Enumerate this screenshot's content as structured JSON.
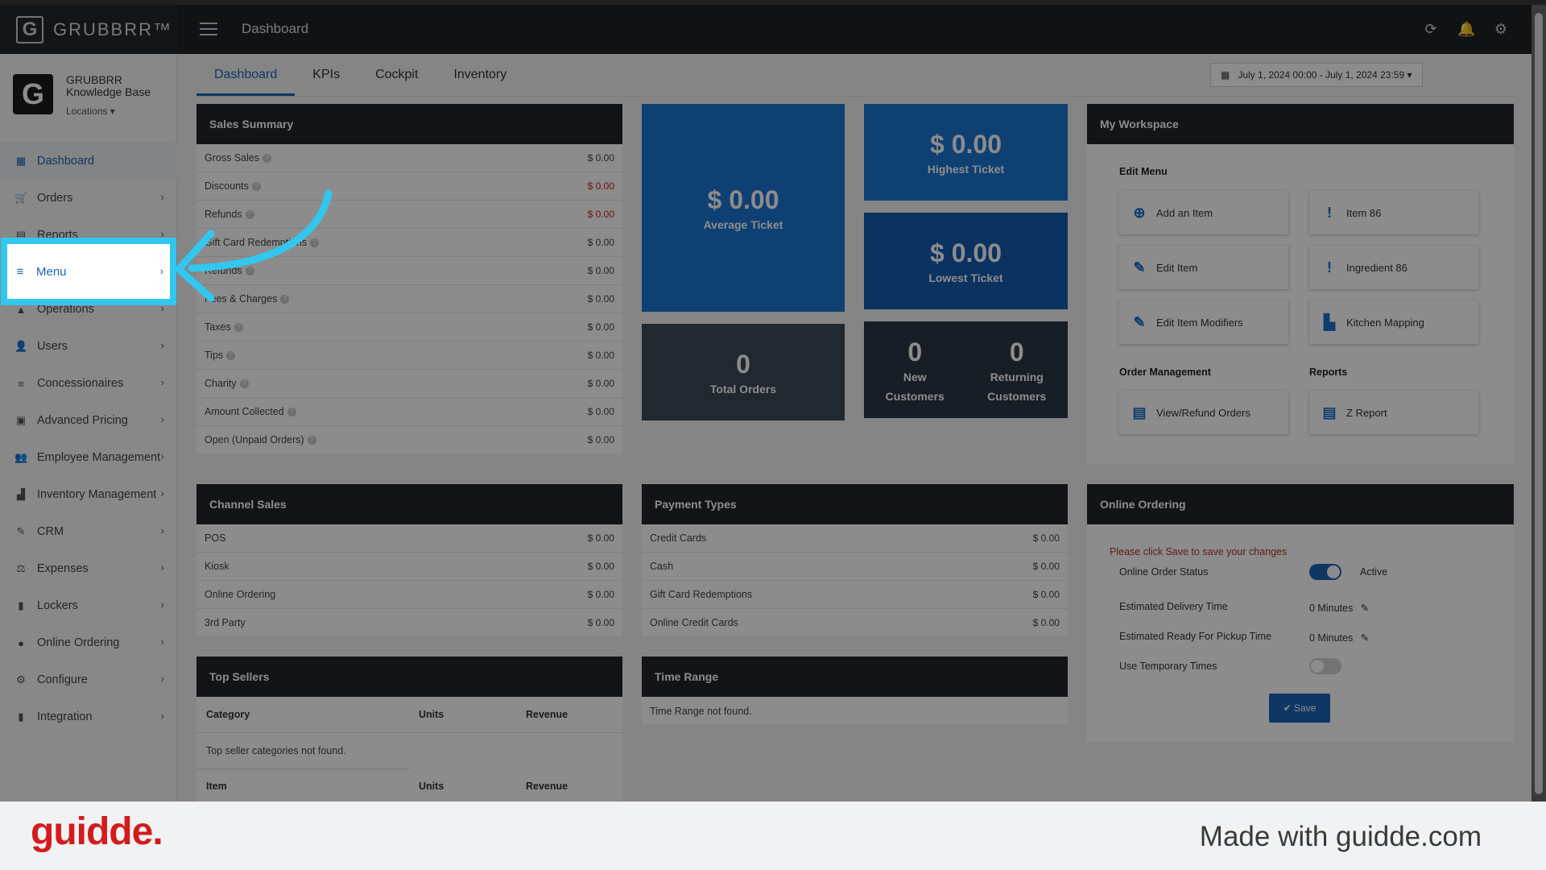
{
  "app": {
    "brand": "GRUBBRR™",
    "logo_letter": "G",
    "header_title": "Dashboard"
  },
  "org": {
    "avatar_letter": "G",
    "name_line1": "GRUBBRR",
    "name_line2": "Knowledge Base",
    "locations_label": "Locations ▾"
  },
  "sidebar": {
    "items": [
      {
        "label": "Dashboard",
        "icon": "dashboard-icon",
        "glyph": "▦"
      },
      {
        "label": "Orders",
        "icon": "cart-icon",
        "glyph": "🛒"
      },
      {
        "label": "Reports",
        "icon": "report-icon",
        "glyph": "▤"
      },
      {
        "label": "Menu",
        "icon": "list-icon",
        "glyph": "≡"
      },
      {
        "label": "Operations",
        "icon": "operations-icon",
        "glyph": "▲"
      },
      {
        "label": "Users",
        "icon": "users-icon",
        "glyph": "👤"
      },
      {
        "label": "Concessionaires",
        "icon": "list-icon",
        "glyph": "≡"
      },
      {
        "label": "Advanced Pricing",
        "icon": "pricing-icon",
        "glyph": "▣"
      },
      {
        "label": "Employee Management",
        "icon": "employees-icon",
        "glyph": "👥"
      },
      {
        "label": "Inventory Management",
        "icon": "inventory-icon",
        "glyph": "▟"
      },
      {
        "label": "CRM",
        "icon": "crm-icon",
        "glyph": "✎"
      },
      {
        "label": "Expenses",
        "icon": "scale-icon",
        "glyph": "⚖"
      },
      {
        "label": "Lockers",
        "icon": "lockers-icon",
        "glyph": "▮"
      },
      {
        "label": "Online Ordering",
        "icon": "globe-icon",
        "glyph": "●"
      },
      {
        "label": "Configure",
        "icon": "gear-icon",
        "glyph": "⚙"
      },
      {
        "label": "Integration",
        "icon": "integration-icon",
        "glyph": "▮"
      }
    ]
  },
  "tabs": [
    "Dashboard",
    "KPIs",
    "Cockpit",
    "Inventory"
  ],
  "date_range": "July 1, 2024 00:00 - July 1, 2024 23:59 ▾",
  "sales_summary": {
    "title": "Sales Summary",
    "rows": [
      {
        "label": "Gross Sales",
        "value": "$ 0.00",
        "red": false
      },
      {
        "label": "Discounts",
        "value": "$ 0.00",
        "red": true
      },
      {
        "label": "Refunds",
        "value": "$ 0.00",
        "red": true
      },
      {
        "label": "Gift Card Redemptions",
        "value": "$ 0.00",
        "red": false
      },
      {
        "label": "Refunds",
        "value": "$ 0.00",
        "red": false
      },
      {
        "label": "Fees & Charges",
        "value": "$ 0.00",
        "red": false
      },
      {
        "label": "Taxes",
        "value": "$ 0.00",
        "red": false
      },
      {
        "label": "Tips",
        "value": "$ 0.00",
        "red": false
      },
      {
        "label": "Charity",
        "value": "$ 0.00",
        "red": false
      },
      {
        "label": "Amount Collected",
        "value": "$ 0.00",
        "red": false
      },
      {
        "label": "Open (Unpaid Orders)",
        "value": "$ 0.00",
        "red": false
      }
    ]
  },
  "kpis": {
    "average_ticket": {
      "value": "$ 0.00",
      "label": "Average Ticket"
    },
    "highest_ticket": {
      "value": "$ 0.00",
      "label": "Highest Ticket"
    },
    "lowest_ticket": {
      "value": "$ 0.00",
      "label": "Lowest Ticket"
    },
    "total_orders": {
      "value": "0",
      "label": "Total Orders"
    },
    "new_customers": {
      "value": "0",
      "label_1": "New",
      "label_2": "Customers"
    },
    "returning_customers": {
      "value": "0",
      "label_1": "Returning",
      "label_2": "Customers"
    }
  },
  "workspace": {
    "title": "My Workspace",
    "edit_menu_heading": "Edit Menu",
    "order_mgmt_heading": "Order Management",
    "reports_heading": "Reports",
    "buttons": {
      "add_item": "Add an Item",
      "item_86": "Item 86",
      "edit_item": "Edit Item",
      "ingredient_86": "Ingredient 86",
      "edit_modifiers": "Edit Item Modifiers",
      "kitchen_mapping": "Kitchen Mapping",
      "view_refund": "View/Refund Orders",
      "z_report": "Z Report"
    }
  },
  "channel_sales": {
    "title": "Channel Sales",
    "rows": [
      {
        "label": "POS",
        "value": "$ 0.00"
      },
      {
        "label": "Kiosk",
        "value": "$ 0.00"
      },
      {
        "label": "Online Ordering",
        "value": "$ 0.00"
      },
      {
        "label": "3rd Party",
        "value": "$ 0.00"
      }
    ]
  },
  "payment_types": {
    "title": "Payment Types",
    "rows": [
      {
        "label": "Credit Cards",
        "value": "$ 0.00"
      },
      {
        "label": "Cash",
        "value": "$ 0.00"
      },
      {
        "label": "Gift Card Redemptions",
        "value": "$ 0.00"
      },
      {
        "label": "Online Credit Cards",
        "value": "$ 0.00"
      }
    ]
  },
  "online_ordering": {
    "title": "Online Ordering",
    "notice": "Please click Save to save your changes",
    "status_label": "Online Order Status",
    "status_value": "Active",
    "delivery_label": "Estimated Delivery Time",
    "delivery_value": "0 Minutes",
    "pickup_label": "Estimated Ready For Pickup Time",
    "pickup_value": "0 Minutes",
    "temp_label": "Use Temporary Times",
    "save_label": "✔ Save",
    "status_on": true,
    "temp_on": false
  },
  "top_sellers": {
    "title": "Top Sellers",
    "col_category": "Category",
    "col_units": "Units",
    "col_revenue": "Revenue",
    "empty": "Top seller categories not found.",
    "col_item": "Item",
    "col_units2": "Units",
    "col_revenue2": "Revenue"
  },
  "time_range": {
    "title": "Time Range",
    "empty": "Time Range not found."
  },
  "overlay": {
    "highlight_label": "Menu",
    "highlight_color": "#31c7ee"
  },
  "footer": {
    "logo": "guidde.",
    "tagline": "Made with guidde.com"
  }
}
